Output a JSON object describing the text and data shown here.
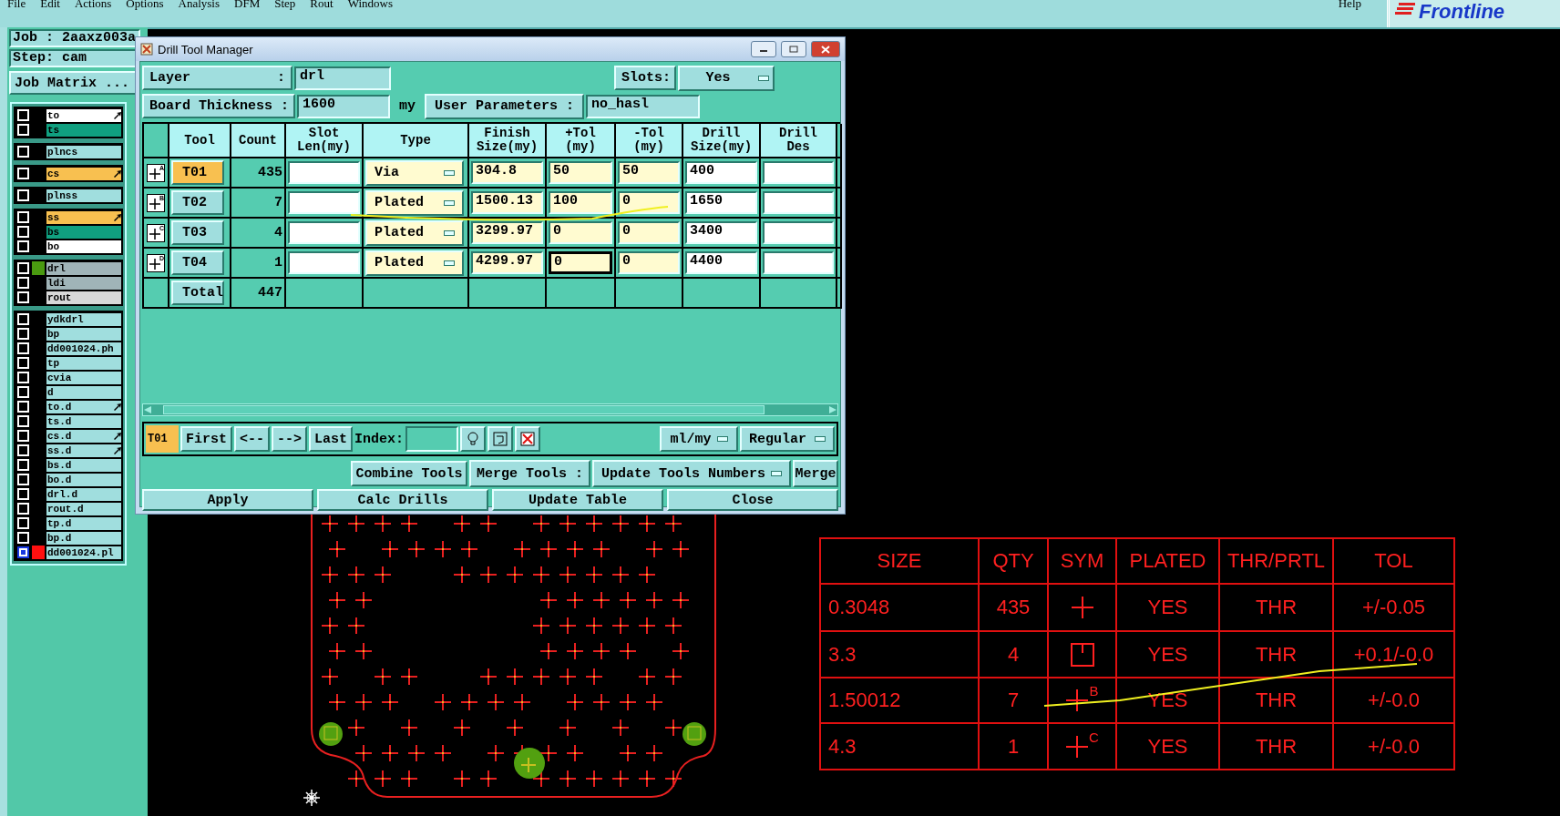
{
  "menu": {
    "items": [
      "File",
      "Edit",
      "Actions",
      "Options",
      "Analysis",
      "DFM",
      "Step",
      "Rout",
      "Windows"
    ],
    "help": "Help",
    "logo": "Frontline"
  },
  "job_panel": {
    "job": "Job : 2aaxz003a",
    "step": "Step: cam",
    "matrix_button": "Job Matrix ...",
    "layer_groups": [
      {
        "items": [
          {
            "name": "to",
            "color": "#ffffff",
            "arrow": true,
            "active": false
          },
          {
            "name": "ts",
            "color": "#10a080",
            "arrow": false,
            "active": false
          }
        ]
      },
      {
        "items": [
          {
            "name": "plncs",
            "color": "#a0dede",
            "arrow": false,
            "active": false
          }
        ]
      },
      {
        "items": [
          {
            "name": "cs",
            "color": "#f8c050",
            "arrow": true,
            "active": false
          }
        ]
      },
      {
        "items": [
          {
            "name": "plnss",
            "color": "#a0dede",
            "arrow": false,
            "active": false
          }
        ]
      },
      {
        "items": [
          {
            "name": "ss",
            "color": "#f8c050",
            "arrow": true,
            "active": false
          },
          {
            "name": "bs",
            "color": "#10a080",
            "arrow": false,
            "active": false
          },
          {
            "name": "bo",
            "color": "#ffffff",
            "arrow": false,
            "active": false
          }
        ]
      },
      {
        "items": [
          {
            "name": "drl",
            "color": "#a0b4b8",
            "marker": {
              "color": "#4a9a10"
            },
            "arrow": false,
            "active": false
          },
          {
            "name": "ldi",
            "color": "#a0b4b8",
            "arrow": false,
            "active": false
          },
          {
            "name": "rout",
            "color": "#d8d8d8",
            "arrow": false,
            "active": false
          }
        ]
      },
      {
        "items": [
          {
            "name": "ydkdrl",
            "color": "#a0dede",
            "arrow": false,
            "active": false
          },
          {
            "name": "bp",
            "color": "#a0dede",
            "arrow": false,
            "active": false
          },
          {
            "name": "dd001024.ph",
            "color": "#a0dede",
            "arrow": false,
            "active": false
          },
          {
            "name": "tp",
            "color": "#a0dede",
            "arrow": false,
            "active": false
          },
          {
            "name": "cvia",
            "color": "#a0dede",
            "arrow": false,
            "active": false
          },
          {
            "name": "d",
            "color": "#a0dede",
            "arrow": false,
            "active": false
          },
          {
            "name": "to.d",
            "color": "#a0dede",
            "arrow": true,
            "active": false
          },
          {
            "name": "ts.d",
            "color": "#a0dede",
            "arrow": false,
            "active": false
          },
          {
            "name": "cs.d",
            "color": "#a0dede",
            "arrow": true,
            "active": false
          },
          {
            "name": "ss.d",
            "color": "#a0dede",
            "arrow": true,
            "active": false
          },
          {
            "name": "bs.d",
            "color": "#a0dede",
            "arrow": false,
            "active": false
          },
          {
            "name": "bo.d",
            "color": "#a0dede",
            "arrow": false,
            "active": false
          },
          {
            "name": "drl.d",
            "color": "#a0dede",
            "arrow": false,
            "active": false
          },
          {
            "name": "rout.d",
            "color": "#a0dede",
            "arrow": false,
            "active": false
          },
          {
            "name": "tp.d",
            "color": "#a0dede",
            "arrow": false,
            "active": false
          },
          {
            "name": "bp.d",
            "color": "#a0dede",
            "arrow": false,
            "active": false
          },
          {
            "name": "dd001024.pl",
            "color": "#a0dede",
            "marker": {
              "color": "#ff1010"
            },
            "arrow": false,
            "active": true
          }
        ]
      }
    ]
  },
  "dialog": {
    "title": "Drill Tool Manager",
    "layer_label": "Layer",
    "layer_colon": ":",
    "layer_value": "drl",
    "slots_label": "Slots:",
    "slots_value": "Yes",
    "thickness_label": "Board Thickness :",
    "thickness_value": "1600",
    "thickness_unit": "my",
    "user_params_button": "User Parameters :",
    "user_params_value": "no_hasl",
    "columns": [
      "Tool",
      "Count",
      "Slot\nLen(my)",
      "Type",
      "Finish\nSize(my)",
      "+Tol\n(my)",
      "-Tol\n(my)",
      "Drill\nSize(my)",
      "Drill\nDes"
    ],
    "tools": [
      {
        "symbol_letter": "A",
        "tool": "T01",
        "selected": true,
        "count": "435",
        "type": "Via",
        "finish": "304.8",
        "plus_tol": "50",
        "minus_tol": "50",
        "drill_size": "400",
        "plus_tol_focused": false
      },
      {
        "symbol_letter": "B",
        "tool": "T02",
        "selected": false,
        "count": "7",
        "type": "Plated",
        "finish": "1500.13",
        "plus_tol": "100",
        "minus_tol": "0",
        "drill_size": "1650",
        "plus_tol_focused": false
      },
      {
        "symbol_letter": "C",
        "tool": "T03",
        "selected": false,
        "count": "4",
        "type": "Plated",
        "finish": "3299.97",
        "plus_tol": "0",
        "minus_tol": "0",
        "drill_size": "3400",
        "plus_tol_focused": false
      },
      {
        "symbol_letter": "D",
        "tool": "T04",
        "selected": false,
        "count": "1",
        "type": "Plated",
        "finish": "4299.97",
        "plus_tol": "0",
        "minus_tol": "0",
        "drill_size": "4400",
        "plus_tol_focused": true
      }
    ],
    "total_label": "Total",
    "total_count": "447",
    "current_tool": "T01",
    "nav_buttons": [
      "First",
      "<--",
      "-->",
      "Last"
    ],
    "index_label": "Index:",
    "units": "ml/my",
    "mode": "Regular",
    "combine_button": "Combine Tools",
    "merge_label": "Merge Tools :",
    "merge_option": "Update Tools Numbers",
    "merge_button": "Merge",
    "bottom_buttons": [
      "Apply",
      "Calc Drills",
      "Update Table",
      "Close"
    ]
  },
  "drill_chart": {
    "columns": [
      "SIZE",
      "QTY",
      "SYM",
      "PLATED",
      "THR/PRTL",
      "TOL"
    ],
    "rows": [
      {
        "size": "0.3048",
        "qty": "435",
        "kind": "cross",
        "plated": "YES",
        "hole": "THR",
        "tol": "+/-0.05"
      },
      {
        "size": "3.3",
        "qty": "4",
        "kind": "square",
        "plated": "YES",
        "hole": "THR",
        "tol": "+0.1/-0.0"
      },
      {
        "size": "1.50012",
        "qty": "7",
        "kind": "cross",
        "letter": "B",
        "plated": "YES",
        "hole": "THR",
        "tol": "+/-0.0"
      },
      {
        "size": "4.3",
        "qty": "1",
        "kind": "cross",
        "letter": "C",
        "plated": "YES",
        "hole": "THR",
        "tol": "+/-0.0"
      }
    ]
  }
}
